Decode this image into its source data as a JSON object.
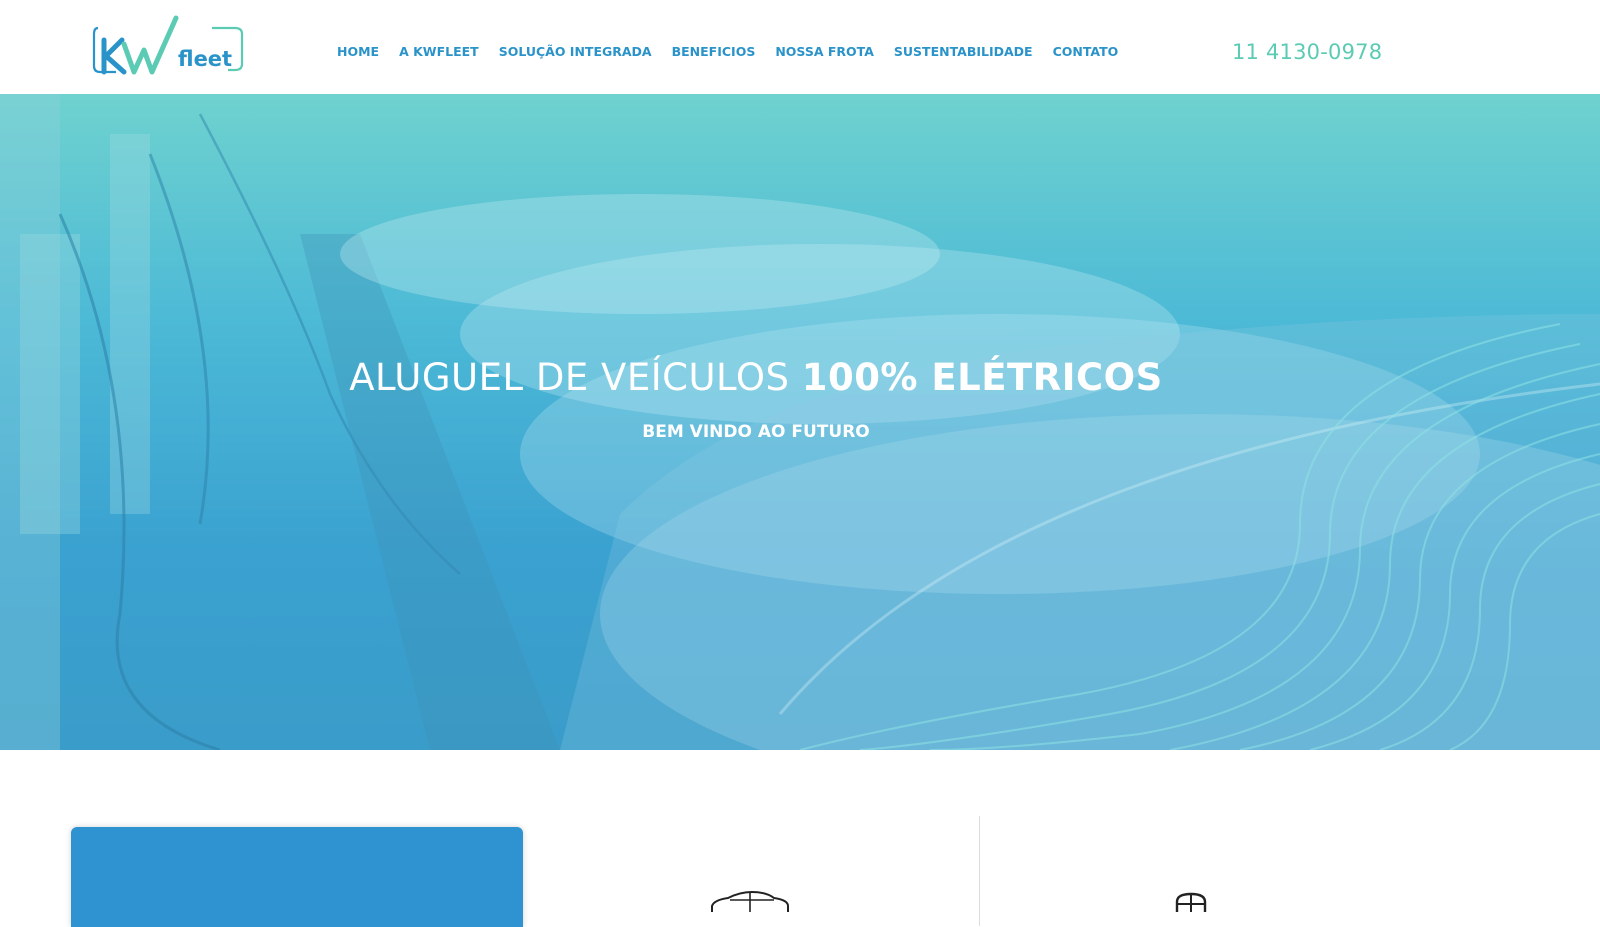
{
  "header": {
    "logo": {
      "main": "Kw",
      "sub": "fleet"
    },
    "nav": [
      {
        "label": "HOME"
      },
      {
        "label": "A KWFLEET"
      },
      {
        "label": "SOLUÇÃO INTEGRADA"
      },
      {
        "label": "BENEFICIOS"
      },
      {
        "label": "NOSSA FROTA"
      },
      {
        "label": "SUSTENTABILIDADE"
      },
      {
        "label": "CONTATO"
      }
    ],
    "phone": "11 4130-0978"
  },
  "hero": {
    "title_light": "ALUGUEL DE VEÍCULOS",
    "title_bold": "100% ELÉTRICOS",
    "subtitle": "BEM VINDO AO FUTURO"
  },
  "icons": [
    "car-icon",
    "hand-icon",
    "logo-check-icon"
  ],
  "colors": {
    "brand_blue": "#2a93c9",
    "brand_green": "#5ccbb4",
    "hero_top": "#6fd2cf",
    "hero_bottom": "#3a9cc9",
    "card_blue": "#2f93d2"
  }
}
